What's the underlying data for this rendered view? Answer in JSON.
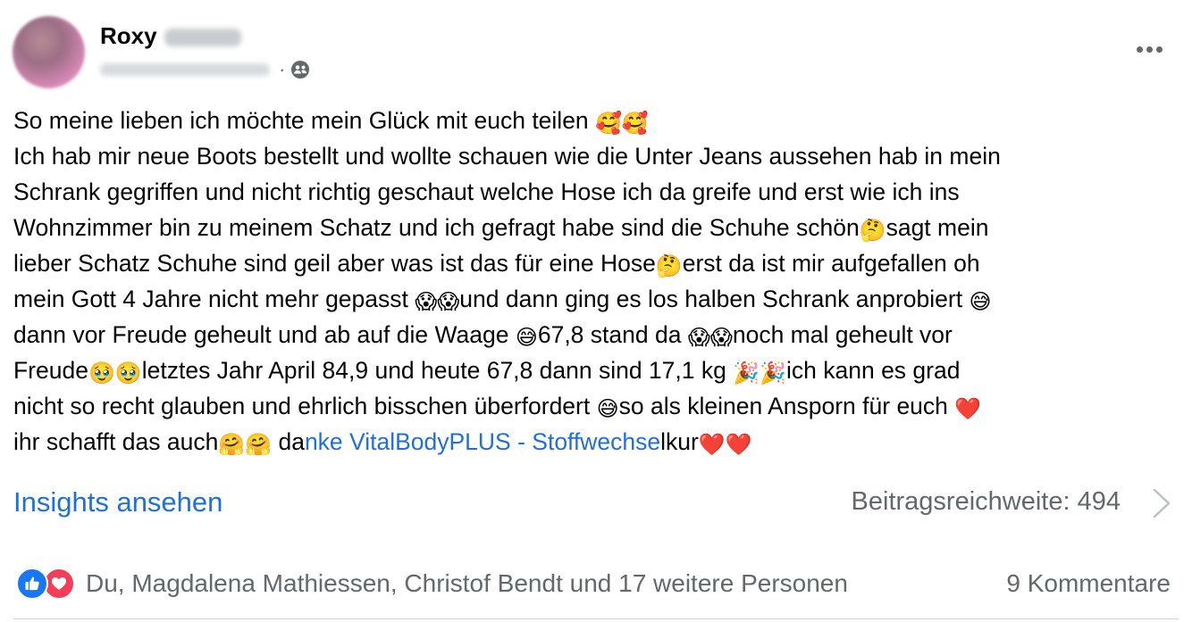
{
  "author": {
    "first_name": "Roxy"
  },
  "post": {
    "lines": [
      [
        {
          "t": "So meine lieben ich möchte mein Glück mit euch teilen "
        },
        {
          "e": "🥰🥰"
        }
      ],
      [
        {
          "t": "Ich hab mir neue Boots bestellt und wollte schauen wie die Unter Jeans aussehen hab in mein"
        }
      ],
      [
        {
          "t": "Schrank gegriffen und nicht richtig geschaut welche Hose ich da greife und erst wie ich ins"
        }
      ],
      [
        {
          "t": "Wohnzimmer bin zu meinem Schatz und ich gefragt habe sind die Schuhe schön"
        },
        {
          "e": "🤔"
        },
        {
          "t": "sagt mein"
        }
      ],
      [
        {
          "t": "lieber Schatz Schuhe sind geil aber was ist das für eine Hose"
        },
        {
          "e": "🤔"
        },
        {
          "t": "erst da ist mir aufgefallen oh"
        }
      ],
      [
        {
          "t": "mein Gott 4 Jahre nicht mehr gepasst "
        },
        {
          "e": "😱😱"
        },
        {
          "t": "und dann ging es los halben Schrank anprobiert "
        },
        {
          "e": "😅"
        }
      ],
      [
        {
          "t": "dann vor Freude geheult und ab auf die Waage "
        },
        {
          "e": "😅"
        },
        {
          "t": "67,8 stand da "
        },
        {
          "e": "😱😱"
        },
        {
          "t": "noch mal geheult vor"
        }
      ],
      [
        {
          "t": "Freude"
        },
        {
          "e": "🥹🥹"
        },
        {
          "t": "letztes Jahr April 84,9 und heute 67,8 dann sind 17,1 kg "
        },
        {
          "e": "🎉🎉"
        },
        {
          "t": "ich kann es grad"
        }
      ],
      [
        {
          "t": "nicht so recht glauben und ehrlich bisschen überfordert "
        },
        {
          "e": "😅"
        },
        {
          "t": "so als kleinen Ansporn für euch "
        },
        {
          "e": "❤️"
        }
      ],
      [
        {
          "t": "ihr schafft das auch"
        },
        {
          "e": "🤗🤗"
        },
        {
          "t": " da"
        },
        {
          "l": "nke VitalBodyPLUS - Stoffwechse"
        },
        {
          "t": "lkur"
        },
        {
          "e": "❤️❤️"
        }
      ]
    ]
  },
  "insights_label": "Insights ansehen",
  "reach_label": "Beitragsreichweite: 494",
  "reactions": {
    "text": "Du, Magdalena Mathiessen, Christof Bendt und 17 weitere Personen",
    "icons": [
      "like-icon",
      "love-icon"
    ]
  },
  "comments_label": "9 Kommentare",
  "colors": {
    "link": "#216fdb",
    "secondary_text": "#65676b",
    "like": "#1877f2",
    "love": "#f33e58"
  }
}
